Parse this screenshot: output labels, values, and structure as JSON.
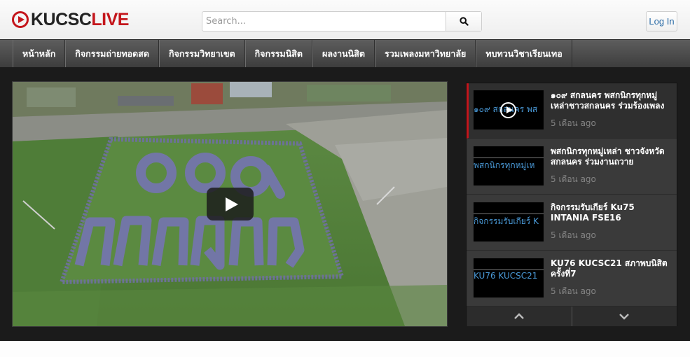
{
  "brand": {
    "part1": "KUCSC",
    "part2": "LIVE",
    "accent_color": "#c4161c",
    "icon": "play-circle-icon"
  },
  "search": {
    "placeholder": "Search...",
    "value": "",
    "button_icon": "search-icon"
  },
  "login": {
    "label": "Log In"
  },
  "nav": {
    "items": [
      {
        "label": "หน้าหลัก"
      },
      {
        "label": "กิจกรรมถ่ายทอดสด"
      },
      {
        "label": "กิจกรรมวิทยาเขต"
      },
      {
        "label": "กิจกรรมนิสิต"
      },
      {
        "label": "ผลงานนิสิต"
      },
      {
        "label": "รวมเพลงมหาวิทยาลัย"
      },
      {
        "label": "ทบทวนวิชาเรียนเทอ"
      }
    ]
  },
  "player": {
    "play_icon": "play-icon",
    "video_text_line1": "๑๐๙",
    "video_text_line2": "สกลนคร"
  },
  "playlist": {
    "items": [
      {
        "title": "๑๐๙ สกลนคร พสกนิกรทุกหมู่เหล่าชาวสกลนคร ร่วมร้องเพลง",
        "thumb_text": "๑๐๙ สกลนคร พส",
        "time": "5 เดือน ago",
        "active": true
      },
      {
        "title": "พสกนิกรทุกหมู่เหล่า ชาวจังหวัดสกลนคร ร่วมงานถวาย",
        "thumb_text": "พสกนิกรทุกหมู่เห",
        "time": "5 เดือน ago",
        "active": false
      },
      {
        "title": "กิจกรรมรับเกียร์ Ku75 INTANIA FSE16",
        "thumb_text": "กิจกรรมรับเกียร์ K",
        "time": "5 เดือน ago",
        "active": false
      },
      {
        "title": "KU76 KUCSC21 สภาพบนิสิต ครั้งที่7",
        "thumb_text": "KU76 KUCSC21",
        "time": "5 เดือน ago",
        "active": false
      }
    ],
    "up_icon": "chevron-up-icon",
    "down_icon": "chevron-down-icon"
  }
}
